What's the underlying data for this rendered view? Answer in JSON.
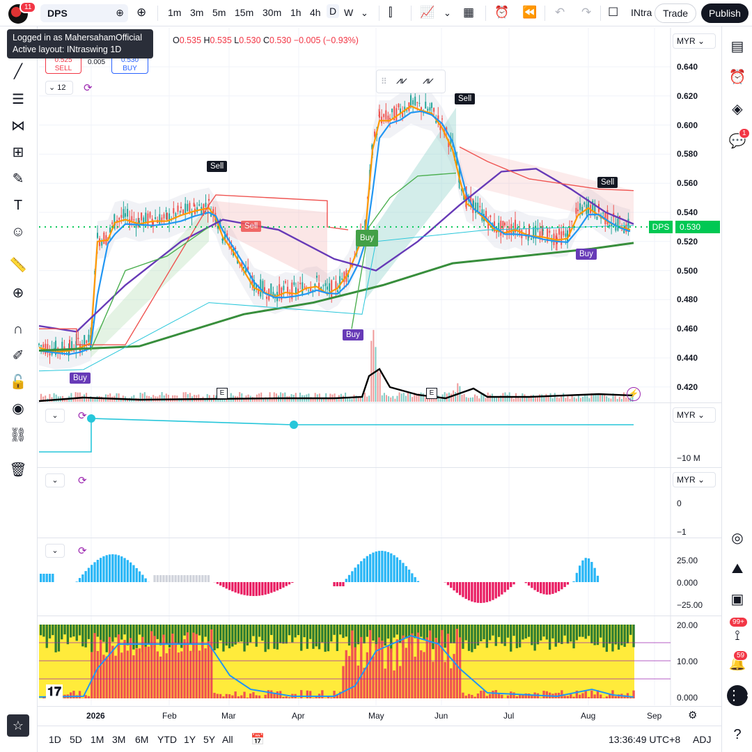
{
  "header": {
    "notification_count": "11",
    "symbol": "DPS",
    "intervals": [
      "1m",
      "3m",
      "5m",
      "15m",
      "30m",
      "1h",
      "4h",
      "D",
      "W"
    ],
    "active_interval": "D",
    "layout_name": "INtra",
    "trade_label": "Trade",
    "publish_label": "Publish"
  },
  "tooltip": {
    "line1": "Logged in as MahersahamOfficial",
    "line2": "Active layout: INtraswing 1D"
  },
  "legend": {
    "o_label": "O",
    "o_value": "0.535",
    "h_label": "H",
    "h_value": "0.535",
    "l_label": "L",
    "l_value": "0.530",
    "c_label": "C",
    "c_value": "0.530",
    "change": "−0.005 (−0.93%)",
    "sell_price": "0.525",
    "sell_label": "SELL",
    "spread": "0.005",
    "buy_price": "0.530",
    "buy_label": "BUY",
    "indicator_count": "12"
  },
  "price_axis": {
    "currency": "MYR",
    "ticks": [
      "0.640",
      "0.620",
      "0.600",
      "0.580",
      "0.560",
      "0.540",
      "0.520",
      "0.500",
      "0.480",
      "0.460",
      "0.440",
      "0.420"
    ],
    "last_price_symbol": "DPS",
    "last_price": "0.530"
  },
  "pane2": {
    "currency": "MYR",
    "tick": "−10 M"
  },
  "pane3": {
    "currency": "MYR",
    "ticks": [
      "0",
      "−1"
    ]
  },
  "pane4": {
    "ticks": [
      "25.00",
      "0.000",
      "−25.00"
    ]
  },
  "pane5": {
    "ticks": [
      "20.00",
      "10.00",
      "0.000"
    ]
  },
  "signals": {
    "buy": "Buy",
    "sell": "Sell"
  },
  "earnings_marker": "E",
  "time_axis": [
    "2026",
    "Feb",
    "Mar",
    "Apr",
    "May",
    "Jun",
    "Jul",
    "Aug",
    "Sep"
  ],
  "bottombar": {
    "ranges": [
      "1D",
      "5D",
      "1M",
      "3M",
      "6M",
      "YTD",
      "1Y",
      "5Y",
      "All"
    ],
    "clock": "13:36:49 UTC+8",
    "adj": "ADJ"
  },
  "right_toolbar": {
    "alerts_badge": "1",
    "ideas_badge": "99+",
    "notifications_badge": "59"
  },
  "colors": {
    "up": "#26a69a",
    "down": "#ef5350",
    "accent": "#2962ff",
    "last_price": "#00c853",
    "buy_signal": "#673ab7",
    "sell_signal": "#131722"
  }
}
